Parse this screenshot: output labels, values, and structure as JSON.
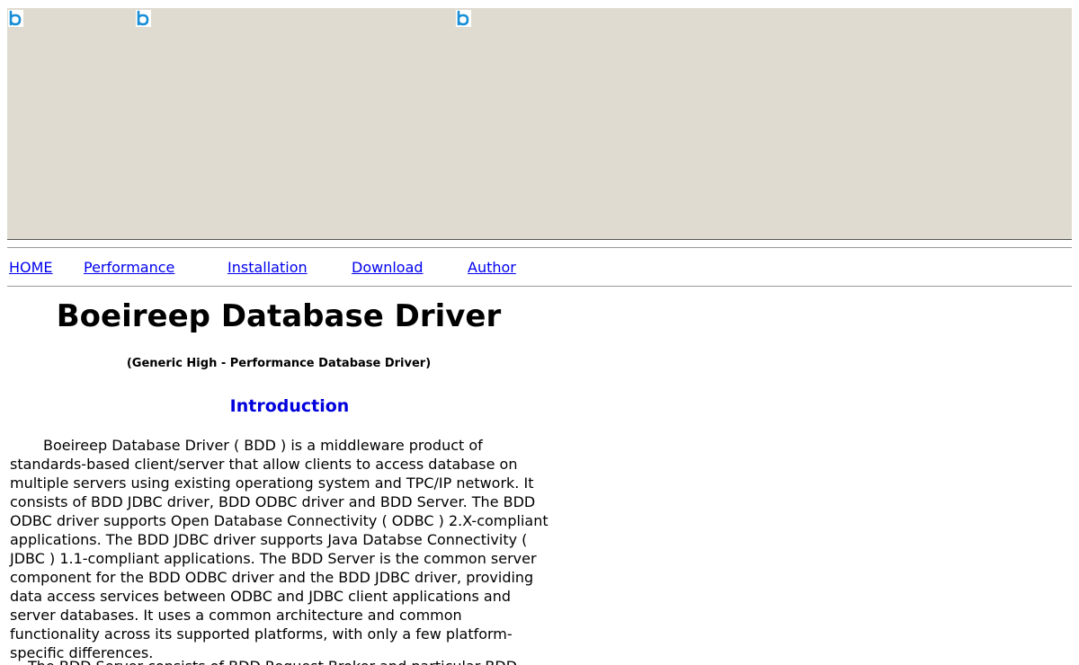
{
  "nav": {
    "home": "HOME",
    "performance": "Performance",
    "installation": "Installation",
    "download": "Download",
    "author": "Author"
  },
  "header": {
    "title": "Boeireep Database Driver",
    "subtitle": "(Generic High - Performance Database Driver)"
  },
  "section": {
    "heading": "Introduction"
  },
  "paragraphs": [
    "Boeireep Database Driver ( BDD ) is a middleware product of standards-based client/server that allow clients to access database on multiple servers using existing operationg system and TPC/IP network.  It consists of BDD JDBC driver, BDD ODBC driver and BDD Server.  The BDD ODBC driver supports Open Database Connectivity ( ODBC ) 2.X-compliant applications.  The BDD JDBC driver supports Java Databse Connectivity ( JDBC ) 1.1-compliant applications.   The BDD Server is the common server component for the BDD ODBC driver and the BDD JDBC driver, providing data access services between ODBC and JDBC client applications and server databases.   It uses a common architecture and common functionality across its supported platforms, with only a few platform-specific differences.",
    "The BDD Server consists of BDD Request Broker and particular BDD ..."
  ],
  "icons": {
    "logo": "logo-icon"
  },
  "colors": {
    "banner_bg": "#dfdbd0",
    "link": "#0000ee",
    "heading": "#0000dd",
    "logo": "#1a8fd6"
  }
}
